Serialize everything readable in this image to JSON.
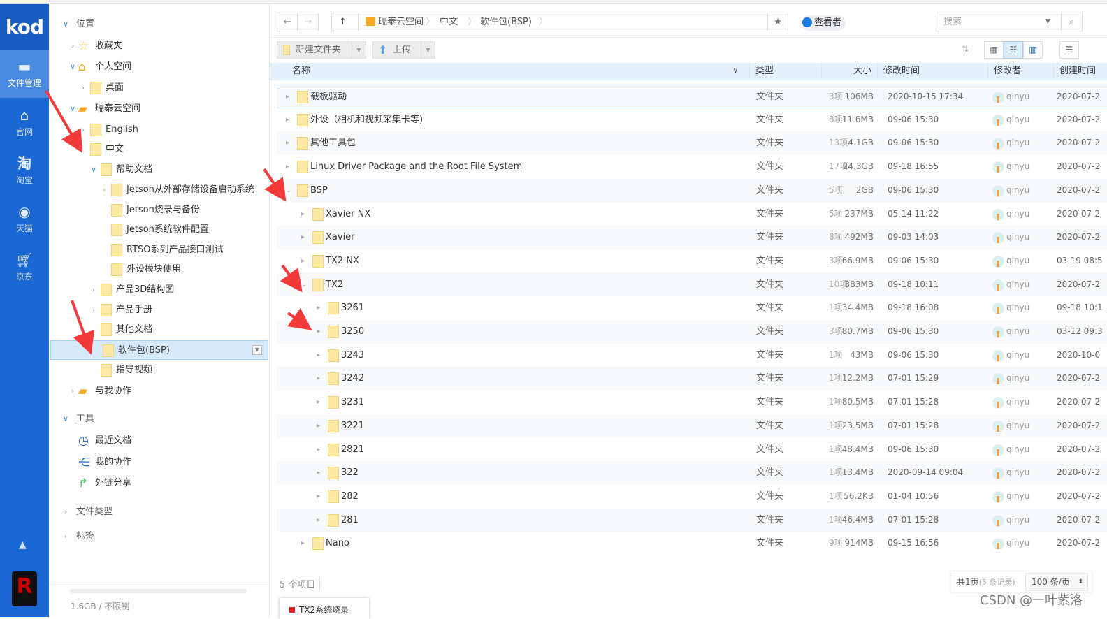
{
  "rail": {
    "logo": "kod",
    "items": [
      {
        "label": "文件管理",
        "icon": "folder-icon"
      },
      {
        "label": "官网",
        "icon": "home-icon"
      },
      {
        "label": "淘宝",
        "icon": "taobao-icon"
      },
      {
        "label": "天猫",
        "icon": "alipay-icon"
      },
      {
        "label": "京东",
        "icon": "cart-icon"
      }
    ]
  },
  "tree": {
    "nodes": [
      {
        "label": "位置"
      },
      {
        "label": "收藏夹"
      },
      {
        "label": "个人空间"
      },
      {
        "label": "桌面"
      },
      {
        "label": "瑞泰云空间"
      },
      {
        "label": "English"
      },
      {
        "label": "中文"
      },
      {
        "label": "帮助文档"
      },
      {
        "label": "Jetson从外部存储设备启动系统"
      },
      {
        "label": "Jetson烧录与备份"
      },
      {
        "label": "Jetson系统软件配置"
      },
      {
        "label": "RTSO系列产品接口测试"
      },
      {
        "label": "外设模块使用"
      },
      {
        "label": "产品3D结构图"
      },
      {
        "label": "产品手册"
      },
      {
        "label": "其他文档"
      },
      {
        "label": "软件包(BSP)"
      },
      {
        "label": "指导视频"
      },
      {
        "label": "与我协作"
      },
      {
        "label": "工具"
      },
      {
        "label": "最近文档"
      },
      {
        "label": "我的协作"
      },
      {
        "label": "外链分享"
      },
      {
        "label": "文件类型"
      },
      {
        "label": "标签"
      }
    ],
    "quota": "1.6GB / 不限制"
  },
  "address": {
    "crumbs": [
      "瑞泰云空间",
      "中文",
      "软件包(BSP)"
    ],
    "viewer": "查看者",
    "search_placeholder": "搜索"
  },
  "toolbar": {
    "new_folder": "新建文件夹",
    "upload": "上传"
  },
  "columns": {
    "name": "名称",
    "type": "类型",
    "size": "大小",
    "mtime": "修改时间",
    "user": "修改者",
    "ctime": "创建时间"
  },
  "rows": [
    {
      "name": "载板驱动",
      "level": 0,
      "type": "文件夹",
      "count": "3项",
      "size": "106MB",
      "mtime": "2020-10-15 17:34",
      "user": "qinyu",
      "ctime": "2020-07-2"
    },
    {
      "name": "外设（相机和视频采集卡等)",
      "level": 0,
      "type": "文件夹",
      "count": "8项",
      "size": "11.6MB",
      "mtime": "09-06 15:30",
      "user": "qinyu",
      "ctime": "2020-07-2"
    },
    {
      "name": "其他工具包",
      "level": 0,
      "type": "文件夹",
      "count": "13项",
      "size": "4.1GB",
      "mtime": "09-06 15:30",
      "user": "qinyu",
      "ctime": "2020-07-2"
    },
    {
      "name": "Linux Driver Package and the Root File System",
      "level": 0,
      "type": "文件夹",
      "count": "17项",
      "size": "24.3GB",
      "mtime": "09-18 16:55",
      "user": "qinyu",
      "ctime": "2020-07-2"
    },
    {
      "name": "BSP",
      "level": 0,
      "open": true,
      "type": "文件夹",
      "count": "5项",
      "size": "2GB",
      "mtime": "09-06 15:30",
      "user": "qinyu",
      "ctime": "2020-07-2"
    },
    {
      "name": "Xavier NX",
      "level": 1,
      "type": "文件夹",
      "count": "5项",
      "size": "237MB",
      "mtime": "05-14 11:22",
      "user": "qinyu",
      "ctime": "2020-07-2"
    },
    {
      "name": "Xavier",
      "level": 1,
      "type": "文件夹",
      "count": "8项",
      "size": "492MB",
      "mtime": "09-03 14:03",
      "user": "qinyu",
      "ctime": "2020-07-2"
    },
    {
      "name": "TX2 NX",
      "level": 1,
      "type": "文件夹",
      "count": "3项",
      "size": "66.9MB",
      "mtime": "09-06 15:30",
      "user": "qinyu",
      "ctime": "03-19 08:5"
    },
    {
      "name": "TX2",
      "level": 1,
      "open": true,
      "type": "文件夹",
      "count": "10项",
      "size": "383MB",
      "mtime": "09-18 10:11",
      "user": "qinyu",
      "ctime": "2020-07-2"
    },
    {
      "name": "3261",
      "level": 2,
      "type": "文件夹",
      "count": "1项",
      "size": "34.4MB",
      "mtime": "09-18 16:08",
      "user": "qinyu",
      "ctime": "09-18 10:1"
    },
    {
      "name": "3250",
      "level": 2,
      "type": "文件夹",
      "count": "3项",
      "size": "80.7MB",
      "mtime": "09-06 15:30",
      "user": "qinyu",
      "ctime": "03-12 09:3"
    },
    {
      "name": "3243",
      "level": 2,
      "type": "文件夹",
      "count": "1项",
      "size": "43MB",
      "mtime": "09-06 15:30",
      "user": "qinyu",
      "ctime": "2020-10-0"
    },
    {
      "name": "3242",
      "level": 2,
      "type": "文件夹",
      "count": "1项",
      "size": "12.2MB",
      "mtime": "07-01 15:29",
      "user": "qinyu",
      "ctime": "2020-07-2"
    },
    {
      "name": "3231",
      "level": 2,
      "type": "文件夹",
      "count": "1项",
      "size": "80.5MB",
      "mtime": "07-01 15:28",
      "user": "qinyu",
      "ctime": "2020-07-2"
    },
    {
      "name": "3221",
      "level": 2,
      "type": "文件夹",
      "count": "1项",
      "size": "23.5MB",
      "mtime": "07-01 15:28",
      "user": "qinyu",
      "ctime": "2020-07-2"
    },
    {
      "name": "2821",
      "level": 2,
      "type": "文件夹",
      "count": "1项",
      "size": "48.4MB",
      "mtime": "09-06 15:30",
      "user": "qinyu",
      "ctime": "2020-07-2"
    },
    {
      "name": "322",
      "level": 2,
      "type": "文件夹",
      "count": "1项",
      "size": "13.4MB",
      "mtime": "2020-09-14 09:04",
      "user": "qinyu",
      "ctime": "2020-07-2"
    },
    {
      "name": "282",
      "level": 2,
      "type": "文件夹",
      "count": "1项",
      "size": "56.2KB",
      "mtime": "01-04 10:56",
      "user": "qinyu",
      "ctime": "2020-07-2"
    },
    {
      "name": "281",
      "level": 2,
      "type": "文件夹",
      "count": "1项",
      "size": "46.4MB",
      "mtime": "07-01 15:28",
      "user": "qinyu",
      "ctime": "2020-07-2"
    },
    {
      "name": "Nano",
      "level": 1,
      "type": "文件夹",
      "count": "9项",
      "size": "914MB",
      "mtime": "09-15 16:56",
      "user": "qinyu",
      "ctime": "2020-07-2"
    }
  ],
  "footer": {
    "item_count": "5 个项目",
    "pages": "共1页",
    "records": "(5 条记录)",
    "per_page": "100 条/页",
    "open_tab": "TX2系统烧录"
  },
  "watermark": "CSDN @一叶紫洛",
  "colors": {
    "rail": "#1b68d4",
    "selected": "#d6e9fb",
    "header": "#e4f0fb",
    "arrow": "#f23a3a"
  }
}
